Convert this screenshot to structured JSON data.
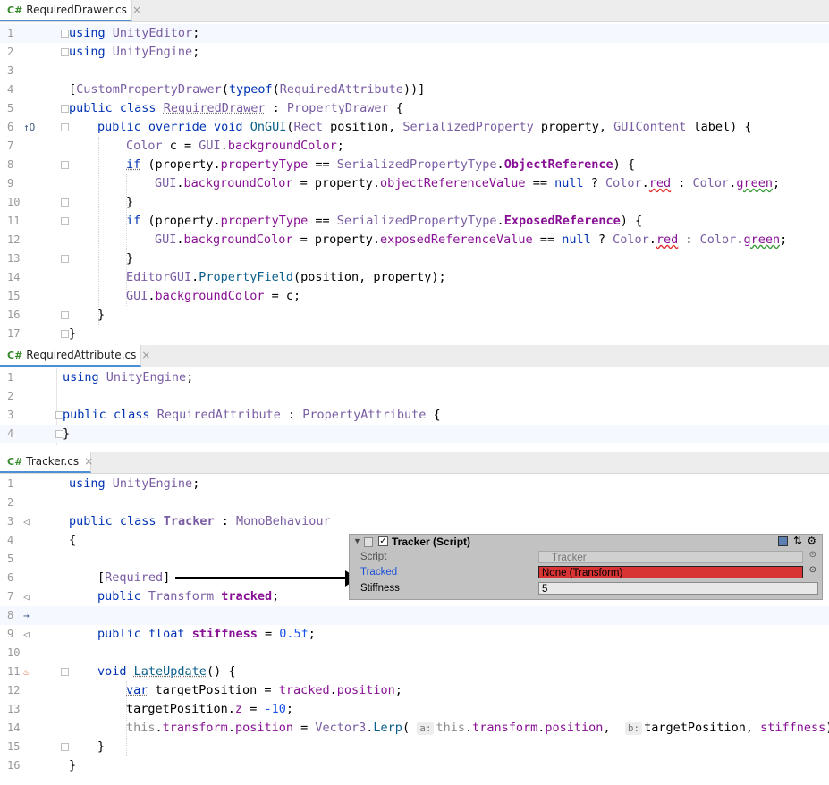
{
  "tabs": [
    {
      "icon": "C#",
      "label": "RequiredDrawer.cs",
      "close": "×"
    },
    {
      "icon": "C#",
      "label": "RequiredAttribute.cs",
      "close": "×"
    },
    {
      "icon": "C#",
      "label": "Tracker.cs",
      "close": "×"
    }
  ],
  "files": {
    "drawer": {
      "line_numbers": [
        "1",
        "2",
        "3",
        "4",
        "5",
        "6",
        "7",
        "8",
        "9",
        "10",
        "11",
        "12",
        "13",
        "14",
        "15",
        "16",
        "17"
      ]
    },
    "attribute": {
      "line_numbers": [
        "1",
        "2",
        "3",
        "4"
      ]
    },
    "tracker": {
      "line_numbers": [
        "1",
        "2",
        "3",
        "4",
        "5",
        "6",
        "7",
        "8",
        "9",
        "10",
        "11",
        "12",
        "13",
        "14",
        "15",
        "16"
      ]
    }
  },
  "inline_hints": {
    "a": "a:",
    "b": "b:"
  },
  "inspector": {
    "title": "Tracker (Script)",
    "rows": [
      {
        "label": "Script",
        "value": "Tracker"
      },
      {
        "label": "Tracked",
        "value": "None (Transform)"
      },
      {
        "label": "Stiffness",
        "value": "5"
      }
    ],
    "colors": {
      "panel": "#c2c2c2",
      "tracked_label": "#1a4fd6",
      "tracked_field": "#d93434"
    }
  },
  "accent_colors": {
    "keyword": "#0033b3",
    "member": "#871094",
    "number": "#1750eb",
    "tab_underline": "#4c8fd6"
  }
}
